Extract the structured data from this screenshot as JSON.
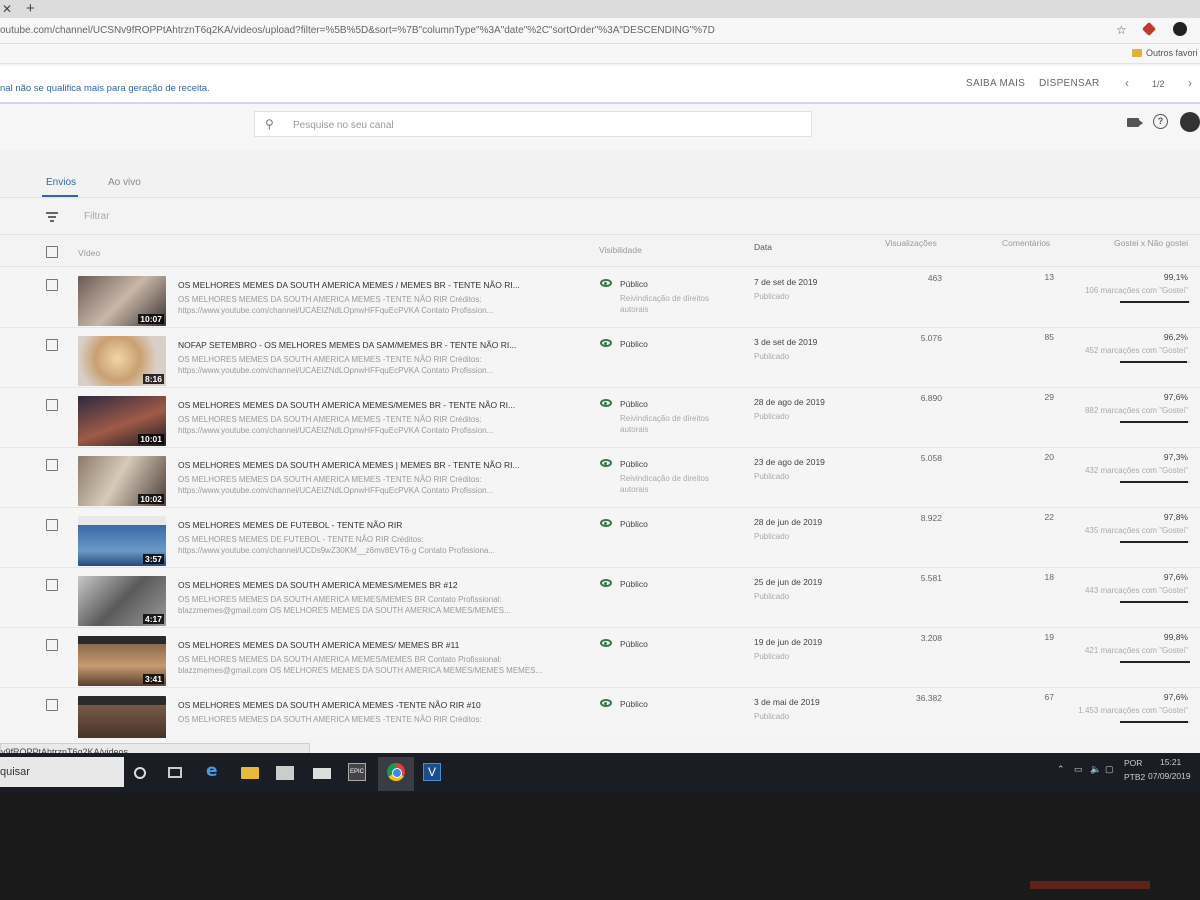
{
  "browser": {
    "url": "outube.com/channel/UCSNv9fROPPtAhtrznT6q2KA/videos/upload?filter=%5B%5D&sort=%7B\"columnType\"%3A\"date\"%2C\"sortOrder\"%3A\"DESCENDING\"%7D",
    "bookmark_folder": "Outros favori"
  },
  "notice": {
    "message": "nal não se qualifica mais para geração de receita.",
    "learn_more": "SAIBA MAIS",
    "dismiss": "DISPENSAR",
    "pager": "1/2"
  },
  "header": {
    "search_placeholder": "Pesquise no seu canal"
  },
  "tabs": [
    {
      "label": "Envios",
      "active": true
    },
    {
      "label": "Ao vivo",
      "active": false
    }
  ],
  "filter": {
    "label": "Filtrar"
  },
  "columns": {
    "video": "Vídeo",
    "visibility": "Visibilidade",
    "date": "Data",
    "views": "Visualizações",
    "comments": "Comentários",
    "likes": "Gostei x Não gostei"
  },
  "videos": [
    {
      "title": "OS MELHORES MEMES DA SOUTH AMERICA MEMES / MEMES BR - TENTE NÃO RI...",
      "desc1": "OS MELHORES MEMES DA SOUTH AMERICA MEMES -TENTE NÃO RIR Créditos:",
      "desc2": "https://www.youtube.com/channel/UCAEIZNdLOpnwHFFquEcPVKA Contato Profission...",
      "duration": "10:07",
      "visibility": "Público",
      "claim": "Reivindicação de direitos autorais",
      "date": "7 de set de 2019",
      "status": "Publicado",
      "views": "463",
      "comments": "13",
      "like_pct": "99,1%",
      "like_count": "106 marcações com \"Gostei\"",
      "like_ratio": 0.991
    },
    {
      "title": "NOFAP SETEMBRO - OS MELHORES MEMES DA SAM/MEMES BR - TENTE NÃO RI...",
      "desc1": "OS MELHORES MEMES DA SOUTH AMERICA MEMES -TENTE NÃO RIR Créditos:",
      "desc2": "https://www.youtube.com/channel/UCAEIZNdLOpnwHFFquEcPVKA Contato Profission...",
      "duration": "8:16",
      "visibility": "Público",
      "claim": "",
      "date": "3 de set de 2019",
      "status": "Publicado",
      "views": "5.076",
      "comments": "85",
      "like_pct": "96,2%",
      "like_count": "452 marcações com \"Gostei\"",
      "like_ratio": 0.962
    },
    {
      "title": "OS MELHORES MEMES DA SOUTH AMERICA MEMES/MEMES BR - TENTE NÃO RI...",
      "desc1": "OS MELHORES MEMES DA SOUTH AMERICA MEMES -TENTE NÃO RIR Créditos:",
      "desc2": "https://www.youtube.com/channel/UCAEIZNdLOpnwHFFquEcPVKA Contato Profission...",
      "duration": "10:01",
      "visibility": "Público",
      "claim": "Reivindicação de direitos autorais",
      "date": "28 de ago de 2019",
      "status": "Publicado",
      "views": "6.890",
      "comments": "29",
      "like_pct": "97,6%",
      "like_count": "882 marcações com \"Gostei\"",
      "like_ratio": 0.976
    },
    {
      "title": "OS MELHORES MEMES DA SOUTH AMERICA MEMES | MEMES BR - TENTE NÃO RI...",
      "desc1": "OS MELHORES MEMES DA SOUTH AMERICA MEMES -TENTE NÃO RIR Créditos:",
      "desc2": "https://www.youtube.com/channel/UCAEIZNdLOpnwHFFquEcPVKA Contato Profission...",
      "duration": "10:02",
      "visibility": "Público",
      "claim": "Reivindicação de direitos autorais",
      "date": "23 de ago de 2019",
      "status": "Publicado",
      "views": "5.058",
      "comments": "20",
      "like_pct": "97,3%",
      "like_count": "432 marcações com \"Gostei\"",
      "like_ratio": 0.973
    },
    {
      "title": "OS MELHORES MEMES DE FUTEBOL - TENTE NÃO RIR",
      "desc1": "OS MELHORES MEMES DE FUTEBOL - TENTE NÃO RIR Créditos:",
      "desc2": "https://www.youtube.com/channel/UCDs9wZ30KM__z6mv8EVT6-g Contato Profissiona...",
      "duration": "3:57",
      "visibility": "Público",
      "claim": "",
      "date": "28 de jun de 2019",
      "status": "Publicado",
      "views": "8.922",
      "comments": "22",
      "like_pct": "97,8%",
      "like_count": "435 marcações com \"Gostei\"",
      "like_ratio": 0.978
    },
    {
      "title": "OS MELHORES MEMES DA SOUTH AMERICA MEMES/MEMES BR #12",
      "desc1": "OS MELHORES MEMES DA SOUTH AMERICA MEMES/MEMES BR Contato Profissional:",
      "desc2": "blazzmemes@gmail.com OS MELHORES MEMES DA SOUTH AMERICA MEMES/MEMES...",
      "duration": "4:17",
      "visibility": "Público",
      "claim": "",
      "date": "25 de jun de 2019",
      "status": "Publicado",
      "views": "5.581",
      "comments": "18",
      "like_pct": "97,6%",
      "like_count": "443 marcações com \"Gostei\"",
      "like_ratio": 0.976
    },
    {
      "title": "OS MELHORES MEMES DA SOUTH AMERICA MEMES/ MEMES BR #11",
      "desc1": "OS MELHORES MEMES DA SOUTH AMERICA MEMES/MEMES BR Contato Profissional:",
      "desc2": "blazzmemes@gmail.com OS MELHORES MEMES DA SOUTH AMERICA MEMES/MEMES MEMES...",
      "duration": "3:41",
      "visibility": "Público",
      "claim": "",
      "date": "19 de jun de 2019",
      "status": "Publicado",
      "views": "3.208",
      "comments": "19",
      "like_pct": "99,8%",
      "like_count": "421 marcações com \"Gostei\"",
      "like_ratio": 0.998
    },
    {
      "title": "OS MELHORES MEMES DA SOUTH AMERICA MEMES -TENTE NÃO RIR #10",
      "desc1": "OS MELHORES MEMES DA SOUTH AMERICA MEMES -TENTE NÃO RIR Créditos:",
      "desc2": "",
      "duration": "",
      "visibility": "Público",
      "claim": "",
      "date": "3 de mai de 2019",
      "status": "Publicado",
      "views": "36.382",
      "comments": "67",
      "like_pct": "97,6%",
      "like_count": "1.453 marcações com \"Gostei\"",
      "like_ratio": 0.976
    }
  ],
  "statusbar": {
    "url": "v9fROPPtAhtrznT6q2KA/videos"
  },
  "taskbar": {
    "search_text": "quisar",
    "epic_label": "EPIC",
    "v_label": "V",
    "lang1": "POR",
    "lang2": "PTB2",
    "time": "15:21",
    "date": "07/09/2019"
  }
}
